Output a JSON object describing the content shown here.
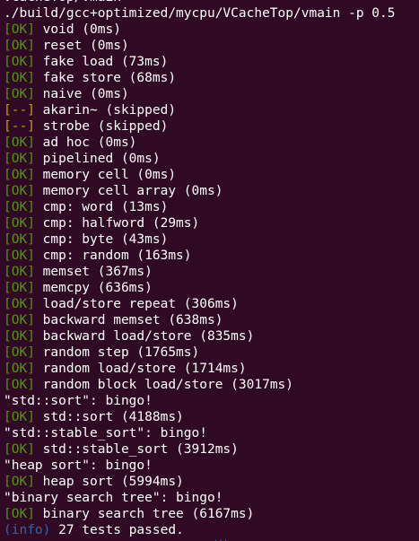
{
  "terminal": {
    "lines": [
      {
        "kind": "plain",
        "text": "VCacheTop/vmain"
      },
      {
        "kind": "plain",
        "text": "./build/gcc+optimized/mycpu/VCacheTop/vmain -p 0.5"
      },
      {
        "kind": "ok",
        "tag": "[OK]",
        "text": " void (0ms)"
      },
      {
        "kind": "ok",
        "tag": "[OK]",
        "text": " reset (0ms)"
      },
      {
        "kind": "ok",
        "tag": "[OK]",
        "text": " fake load (73ms)"
      },
      {
        "kind": "ok",
        "tag": "[OK]",
        "text": " fake store (68ms)"
      },
      {
        "kind": "ok",
        "tag": "[OK]",
        "text": " naive (0ms)"
      },
      {
        "kind": "skip",
        "tag": "[--]",
        "text": " akarin~ (skipped)"
      },
      {
        "kind": "skip",
        "tag": "[--]",
        "text": " strobe (skipped)"
      },
      {
        "kind": "ok",
        "tag": "[OK]",
        "text": " ad hoc (0ms)"
      },
      {
        "kind": "ok",
        "tag": "[OK]",
        "text": " pipelined (0ms)"
      },
      {
        "kind": "ok",
        "tag": "[OK]",
        "text": " memory cell (0ms)"
      },
      {
        "kind": "ok",
        "tag": "[OK]",
        "text": " memory cell array (0ms)"
      },
      {
        "kind": "ok",
        "tag": "[OK]",
        "text": " cmp: word (13ms)"
      },
      {
        "kind": "ok",
        "tag": "[OK]",
        "text": " cmp: halfword (29ms)"
      },
      {
        "kind": "ok",
        "tag": "[OK]",
        "text": " cmp: byte (43ms)"
      },
      {
        "kind": "ok",
        "tag": "[OK]",
        "text": " cmp: random (163ms)"
      },
      {
        "kind": "ok",
        "tag": "[OK]",
        "text": " memset (367ms)"
      },
      {
        "kind": "ok",
        "tag": "[OK]",
        "text": " memcpy (636ms)"
      },
      {
        "kind": "ok",
        "tag": "[OK]",
        "text": " load/store repeat (306ms)"
      },
      {
        "kind": "ok",
        "tag": "[OK]",
        "text": " backward memset (638ms)"
      },
      {
        "kind": "ok",
        "tag": "[OK]",
        "text": " backward load/store (835ms)"
      },
      {
        "kind": "ok",
        "tag": "[OK]",
        "text": " random step (1765ms)"
      },
      {
        "kind": "ok",
        "tag": "[OK]",
        "text": " random load/store (1714ms)"
      },
      {
        "kind": "ok",
        "tag": "[OK]",
        "text": " random block load/store (3017ms)"
      },
      {
        "kind": "plain",
        "text": "\"std::sort\": bingo!"
      },
      {
        "kind": "ok",
        "tag": "[OK]",
        "text": " std::sort (4188ms)"
      },
      {
        "kind": "plain",
        "text": "\"std::stable_sort\": bingo!"
      },
      {
        "kind": "ok",
        "tag": "[OK]",
        "text": " std::stable_sort (3912ms)"
      },
      {
        "kind": "plain",
        "text": "\"heap sort\": bingo!"
      },
      {
        "kind": "ok",
        "tag": "[OK]",
        "text": " heap sort (5994ms)"
      },
      {
        "kind": "plain",
        "text": "\"binary search tree\": bingo!"
      },
      {
        "kind": "ok",
        "tag": "[OK]",
        "text": " binary search tree (6167ms)"
      },
      {
        "kind": "info",
        "tag": "(info)",
        "text": " 27 tests passed."
      }
    ],
    "cursor_hint": "..."
  },
  "colors": {
    "background": "#300a24",
    "text": "#ffffff",
    "ok": "#4e9a06",
    "skip": "#c4a000",
    "info": "#3465a4"
  }
}
